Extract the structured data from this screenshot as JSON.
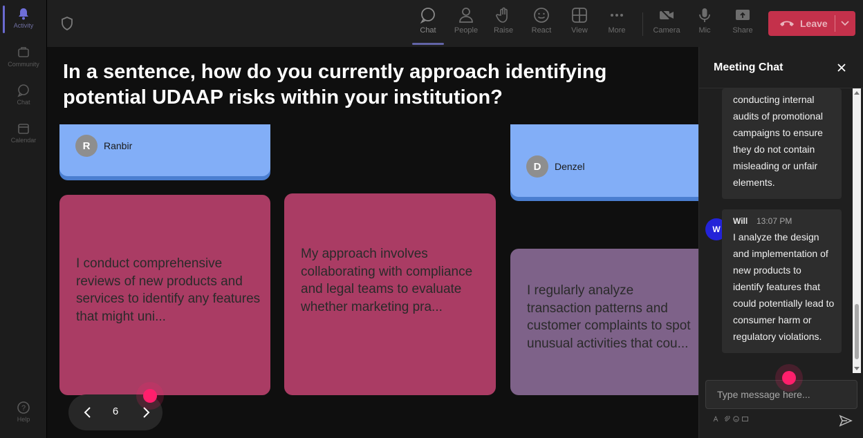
{
  "rail": {
    "items": [
      {
        "label": "Activity",
        "icon": "bell-icon"
      },
      {
        "label": "Community",
        "icon": "community-icon"
      },
      {
        "label": "Chat",
        "icon": "chat-icon"
      },
      {
        "label": "Calendar",
        "icon": "calendar-icon"
      },
      {
        "label": "Help",
        "icon": "help-icon"
      }
    ]
  },
  "toolbar": {
    "chat": "Chat",
    "people": "People",
    "raise": "Raise",
    "react": "React",
    "view": "View",
    "more": "More",
    "camera": "Camera",
    "mic": "Mic",
    "share": "Share",
    "leave": "Leave",
    "leave_color": "#c4314b",
    "active_underline_color": "#6264a7"
  },
  "main": {
    "question": "In a sentence, how do you currently approach identifying potential UDAAP risks within your institution?",
    "cards": [
      {
        "author": "Ranbir",
        "initial": "R"
      },
      {
        "author": "Denzel",
        "initial": "D"
      },
      {
        "text": "I conduct comprehensive reviews of new products and services to identify any features that might uni..."
      },
      {
        "text": "My approach involves collaborating with compliance and legal teams to evaluate whether marketing pra..."
      },
      {
        "text": "I regularly analyze transaction patterns and customer complaints to spot unusual activities that cou..."
      }
    ],
    "page_number": "6"
  },
  "chat": {
    "title": "Meeting Chat",
    "messages": [
      {
        "text": "conducting internal audits of promotional campaigns to ensure they do not contain misleading or unfair elements."
      },
      {
        "author": "Will",
        "initial": "W",
        "time": "13:07 PM",
        "text": "I analyze the design and implementation of new products to identify features that could potentially lead to consumer harm or regulatory violations."
      }
    ],
    "input_placeholder": "Type message here..."
  },
  "colors": {
    "card_blue": "#82aef7",
    "card_magenta": "#aa3c64",
    "card_purple": "#7e6289",
    "cursor": "#ff1f6c",
    "avatar_will": "#2323d8"
  }
}
